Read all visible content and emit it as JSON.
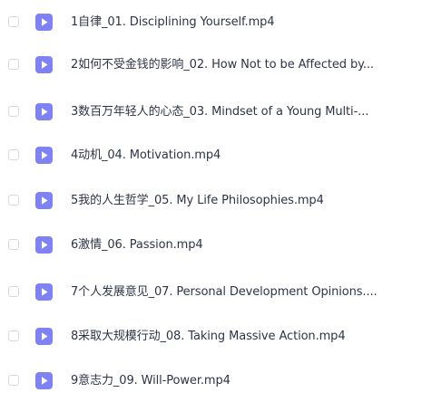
{
  "files": [
    {
      "name": "1自律_01. Disciplining Yourself.mp4",
      "icon": "video-file-icon"
    },
    {
      "name": "2如何不受金钱的影响_02. How Not to be Affected by...",
      "icon": "video-file-icon"
    },
    {
      "name": "3数百万年轻人的心态_03. Mindset of a Young Multi-...",
      "icon": "video-file-icon"
    },
    {
      "name": "4动机_04. Motivation.mp4",
      "icon": "video-file-icon"
    },
    {
      "name": "5我的人生哲学_05. My Life Philosophies.mp4",
      "icon": "video-file-icon"
    },
    {
      "name": "6激情_06. Passion.mp4",
      "icon": "video-file-icon"
    },
    {
      "name": "7个人发展意见_07. Personal Development Opinions....",
      "icon": "video-file-icon"
    },
    {
      "name": "8采取大规模行动_08. Taking Massive Action.mp4",
      "icon": "video-file-icon"
    },
    {
      "name": "9意志力_09. Will-Power.mp4",
      "icon": "video-file-icon"
    }
  ],
  "colors": {
    "icon_background": "#7f82f2",
    "text": "#2f3445",
    "checkbox_border": "#d7d9de"
  }
}
